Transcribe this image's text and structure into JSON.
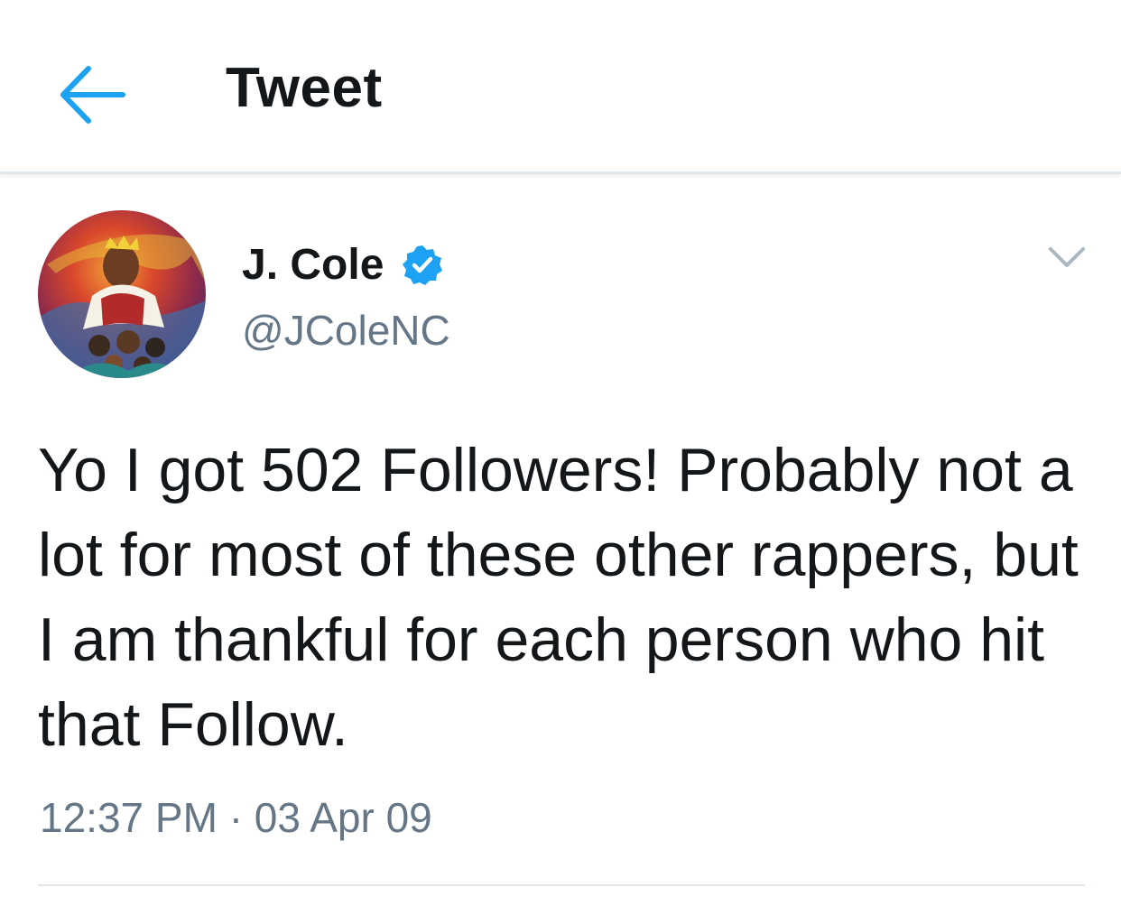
{
  "header": {
    "back_icon": "arrow-left-icon",
    "title": "Tweet",
    "accent_color": "#1da1f2"
  },
  "author": {
    "name": "J. Cole",
    "verified_icon": "verified-badge-icon",
    "handle": "@JColeNC",
    "avatar": "album-art-avatar"
  },
  "tweet": {
    "text": "Yo I got 502 Followers! Probably not a lot for most of these other rappers, but I am thankful for each person who hit that Follow.",
    "time": "12:37 PM",
    "separator": "·",
    "date": "03 Apr 09",
    "menu_icon": "chevron-down-icon"
  }
}
